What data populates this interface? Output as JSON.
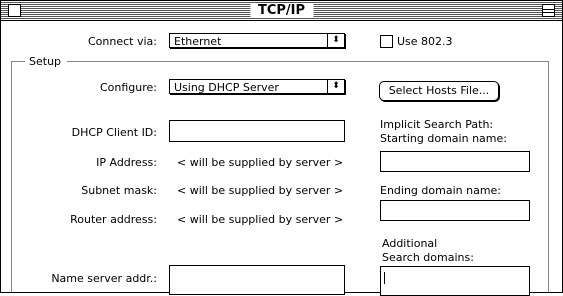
{
  "window": {
    "title": "TCP/IP"
  },
  "connect": {
    "label": "Connect via:",
    "value": "Ethernet"
  },
  "use8023": {
    "label": "Use 802.3"
  },
  "setup": {
    "label": "Setup"
  },
  "configure": {
    "label": "Configure:",
    "value": "Using DHCP Server"
  },
  "select_hosts_button": "Select Hosts File...",
  "dhcp_client_id": {
    "label": "DHCP Client ID:",
    "value": ""
  },
  "ip_address": {
    "label": "IP Address:",
    "value": "< will be supplied by server >"
  },
  "subnet_mask": {
    "label": "Subnet mask:",
    "value": "< will be supplied by server >"
  },
  "router_address": {
    "label": "Router address:",
    "value": "< will be supplied by server >"
  },
  "name_server": {
    "label": "Name server addr.:",
    "value": ""
  },
  "implicit_search": {
    "label_line1": "Implicit Search Path:",
    "label_line2": "Starting domain name:",
    "value": ""
  },
  "ending_domain": {
    "label": "Ending domain name:",
    "value": ""
  },
  "additional_search": {
    "label_line1": "Additional",
    "label_line2": "Search domains:",
    "value": ""
  }
}
